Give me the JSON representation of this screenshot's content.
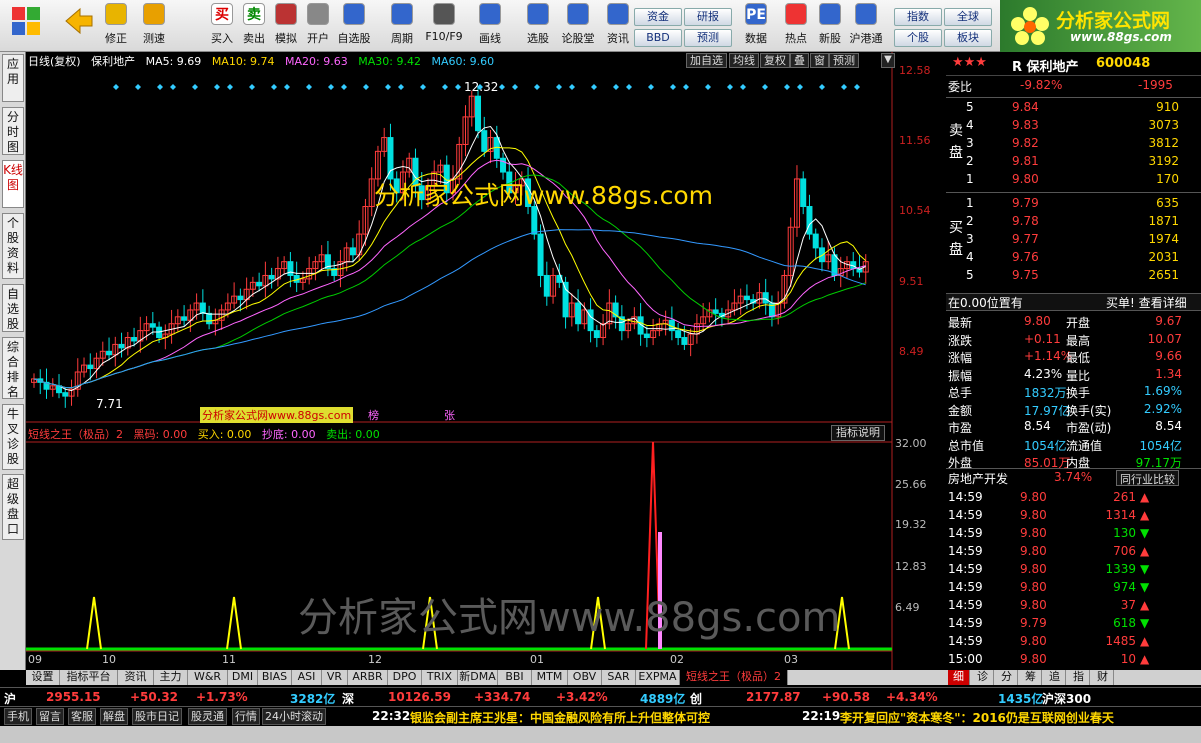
{
  "toolbar": {
    "items": [
      {
        "label": "修正",
        "icon": "up-down-arrows-icon"
      },
      {
        "label": "测速",
        "icon": "speed-icon"
      },
      {
        "label": "买入",
        "icon": "buy-icon",
        "glyph": "买"
      },
      {
        "label": "卖出",
        "icon": "sell-icon",
        "glyph": "卖"
      },
      {
        "label": "模拟",
        "icon": "hammer-icon"
      },
      {
        "label": "开户",
        "icon": "lock-icon"
      },
      {
        "label": "自选股",
        "icon": "star-icon"
      },
      {
        "label": "周期",
        "icon": "clock-icon"
      },
      {
        "label": "F10/F9",
        "icon": "f10-icon"
      },
      {
        "label": "画线",
        "icon": "pen-icon"
      },
      {
        "label": "选股",
        "icon": "filter-icon"
      },
      {
        "label": "论股堂",
        "icon": "forum-icon"
      },
      {
        "label": "资讯",
        "icon": "doc-icon"
      },
      {
        "label": "数据",
        "icon": "pe-icon",
        "glyph": "PE"
      },
      {
        "label": "热点",
        "icon": "flame-icon"
      },
      {
        "label": "新股",
        "icon": "ipo-icon"
      },
      {
        "label": "沪港通",
        "icon": "hkt-icon"
      }
    ],
    "buttons": [
      "资金",
      "研报",
      "指数",
      "全球",
      "BBD",
      "预测",
      "个股",
      "板块"
    ]
  },
  "logo": {
    "title": "分析家公式网",
    "url": "www.88gs.com"
  },
  "left_tabs": [
    "应用",
    "分时图",
    "K线图",
    "个股资料",
    "自选股",
    "综合排名",
    "牛叉诊股",
    "超级盘口"
  ],
  "chart": {
    "header": {
      "period": "日线(复权)",
      "name": "保利地产",
      "ma5": "MA5: 9.69",
      "ma10": "MA10: 9.74",
      "ma20": "MA20: 9.63",
      "ma30": "MA30: 9.42",
      "ma60": "MA60: 9.60"
    },
    "buttons": [
      "加自选",
      "均线",
      "复权",
      "叠",
      "窗",
      "预测"
    ],
    "price_axis": [
      "12.58",
      "11.56",
      "10.54",
      "9.51",
      "8.49"
    ],
    "high_label": "12.32",
    "low_label": "7.71",
    "watermark_top": "分析家公式网www.88gs.com",
    "tag_label": "分析家公式网www.88gs.com",
    "tag_a": "榜",
    "tag_b": "张",
    "ind_header": {
      "name": "短线之王（极品）2",
      "a": "黑码: 0.00",
      "b": "买入: 0.00",
      "c": "抄底: 0.00",
      "d": "卖出: 0.00"
    },
    "ind_button": "指标说明",
    "ind_axis": [
      "32.00",
      "25.66",
      "19.32",
      "12.83",
      "6.49"
    ],
    "watermark_bottom": "分析家公式网www.88gs.com",
    "dates": [
      "09",
      "10",
      "11",
      "12",
      "01",
      "02",
      "03"
    ]
  },
  "right": {
    "title": "R 保利地产",
    "code": "600048",
    "weibi": {
      "label": "委比",
      "pct": "-9.82%",
      "diff": "-1995"
    },
    "sell_label": "卖盘",
    "buy_label": "买盘",
    "asks": [
      {
        "n": "5",
        "p": "9.84",
        "v": "910"
      },
      {
        "n": "4",
        "p": "9.83",
        "v": "3073"
      },
      {
        "n": "3",
        "p": "9.82",
        "v": "3812"
      },
      {
        "n": "2",
        "p": "9.81",
        "v": "3192"
      },
      {
        "n": "1",
        "p": "9.80",
        "v": "170"
      }
    ],
    "bids": [
      {
        "n": "1",
        "p": "9.79",
        "v": "635"
      },
      {
        "n": "2",
        "p": "9.78",
        "v": "1871"
      },
      {
        "n": "3",
        "p": "9.77",
        "v": "1974"
      },
      {
        "n": "4",
        "p": "9.76",
        "v": "2031"
      },
      {
        "n": "5",
        "p": "9.75",
        "v": "2651"
      }
    ],
    "pos": "在0.00位置有",
    "pos_link": "买单! 查看详细",
    "stats": [
      [
        "最新",
        "9.80",
        "开盘",
        "9.67"
      ],
      [
        "涨跌",
        "+0.11",
        "最高",
        "10.07"
      ],
      [
        "涨幅",
        "+1.14%",
        "最低",
        "9.66"
      ],
      [
        "振幅",
        "4.23%",
        "量比",
        "1.34"
      ],
      [
        "总手",
        "1832万",
        "换手",
        "1.69%"
      ],
      [
        "金额",
        "17.97亿",
        "换手(实)",
        "2.92%"
      ],
      [
        "市盈",
        "8.54",
        "市盈(动)",
        "8.54"
      ],
      [
        "总市值",
        "1054亿",
        "流通值",
        "1054亿"
      ],
      [
        "外盘",
        "85.01万",
        "内盘",
        "97.17万"
      ]
    ],
    "industry": {
      "name": "房地产开发",
      "pct": "3.74%",
      "btn": "同行业比较"
    },
    "ticks": [
      [
        "14:59",
        "9.80",
        "261",
        "up"
      ],
      [
        "14:59",
        "9.80",
        "1314",
        "up"
      ],
      [
        "14:59",
        "9.80",
        "130",
        "down"
      ],
      [
        "14:59",
        "9.80",
        "706",
        "up"
      ],
      [
        "14:59",
        "9.80",
        "1339",
        "down"
      ],
      [
        "14:59",
        "9.80",
        "974",
        "down"
      ],
      [
        "14:59",
        "9.80",
        "37",
        "up"
      ],
      [
        "14:59",
        "9.79",
        "618",
        "down"
      ],
      [
        "14:59",
        "9.80",
        "1485",
        "up"
      ],
      [
        "15:00",
        "9.80",
        "10",
        "up"
      ]
    ],
    "tabs": [
      "细",
      "诊",
      "分",
      "筹",
      "追",
      "指",
      "财"
    ]
  },
  "bottom_tabs": [
    "设置",
    "指标平台",
    "资讯",
    "主力",
    "W&R",
    "DMI",
    "BIAS",
    "ASI",
    "VR",
    "ARBR",
    "DPO",
    "TRIX",
    "新DMA",
    "BBI",
    "MTM",
    "OBV",
    "SAR",
    "EXPMA",
    "短线之王（极品）2"
  ],
  "index": {
    "sh": "沪",
    "sh_v": "2955.15",
    "sh_c": "+50.32",
    "sh_p": "+1.73%",
    "sh_a": "3282亿",
    "sz": "深",
    "sz_v": "10126.59",
    "sz_c": "+334.74",
    "sz_p": "+3.42%",
    "sz_a": "4889亿",
    "cy": "创",
    "cy_v": "2177.87",
    "cy_c": "+90.58",
    "cy_p": "+4.34%",
    "cy_a": "1435亿",
    "hs": "沪深300"
  },
  "news": {
    "buttons": [
      "手机",
      "留言",
      "客服",
      "解盘",
      "股市日记",
      "股灵通",
      "行情",
      "24小时滚动"
    ],
    "n1_time": "22:32",
    "n1": "银监会副主席王兆星：中国金融风险有所上升但整体可控",
    "n2_time": "22:19",
    "n2": "李开复回应\"资本寒冬\"：2016仍是互联网创业春天"
  },
  "colors": {
    "up": "#ff3c3c",
    "down": "#00e0e0",
    "ma5": "#ffffff",
    "ma10": "#ffff00",
    "ma20": "#ff66ff",
    "ma30": "#00cc00",
    "ma60": "#3399ff"
  }
}
